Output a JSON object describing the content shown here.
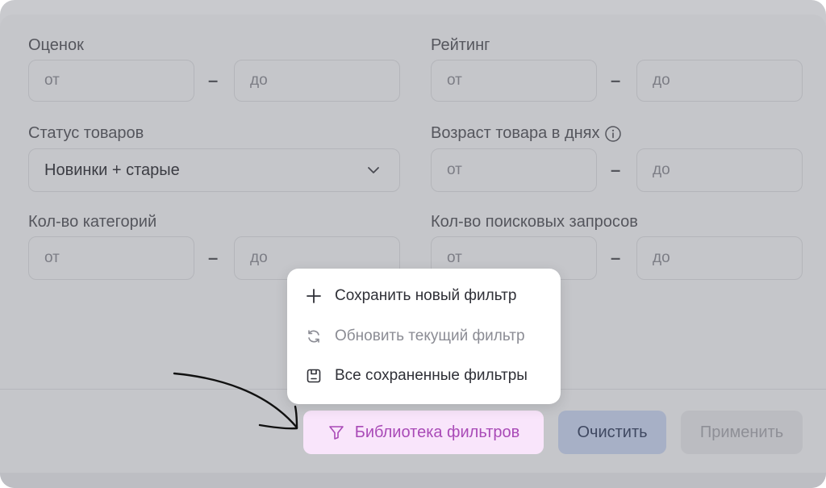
{
  "filters": {
    "ratings_count": {
      "label": "Оценок",
      "from_placeholder": "от",
      "to_placeholder": "до"
    },
    "rating": {
      "label": "Рейтинг",
      "from_placeholder": "от",
      "to_placeholder": "до"
    },
    "product_status": {
      "label": "Статус товаров",
      "selected": "Новинки + старые"
    },
    "product_age": {
      "label": "Возраст товара в днях",
      "from_placeholder": "от",
      "to_placeholder": "до"
    },
    "categories_count": {
      "label": "Кол-во категорий",
      "from_placeholder": "от",
      "to_placeholder": "до"
    },
    "search_queries_count": {
      "label": "Кол-во поисковых запросов",
      "from_placeholder": "от",
      "to_placeholder": "до"
    },
    "range_separator": "–"
  },
  "menu": {
    "items": [
      {
        "label": "Сохранить новый фильтр",
        "icon": "plus-icon",
        "enabled": true
      },
      {
        "label": "Обновить текущий фильтр",
        "icon": "refresh-icon",
        "enabled": false
      },
      {
        "label": "Все сохраненные фильтры",
        "icon": "saved-filters-icon",
        "enabled": true
      }
    ]
  },
  "footer": {
    "library_label": "Библиотека фильтров",
    "clear_label": "Очистить",
    "apply_label": "Применить"
  },
  "colors": {
    "accent": "#a94ab7",
    "accent_bg": "#f9e5fb",
    "clear_bg": "#a7b0c6"
  }
}
